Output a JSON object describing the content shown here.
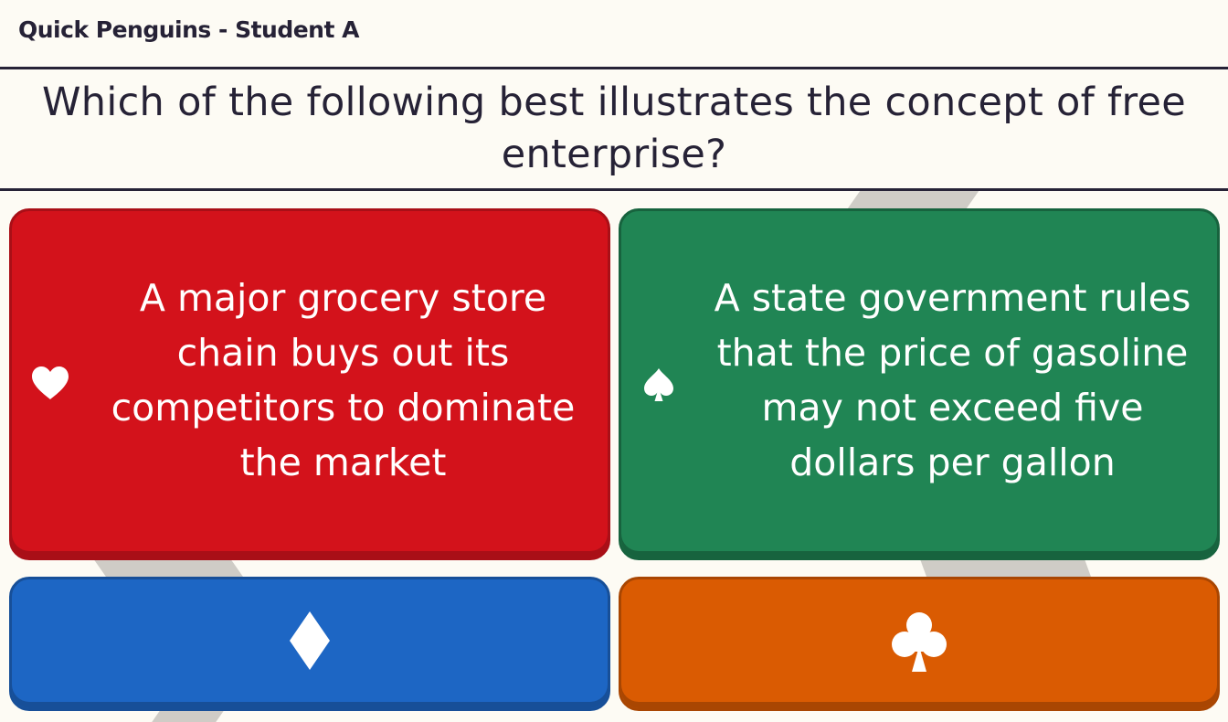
{
  "header": {
    "title": "Quick Penguins - Student A"
  },
  "question": {
    "text": "Which of the following best illustrates the concept of free enterprise?"
  },
  "answers": [
    {
      "suit": "heart-icon",
      "color": "#d3121b",
      "text": "A major grocery store chain buys out its competitors to dominate the market"
    },
    {
      "suit": "spade-icon",
      "color": "#208554",
      "text": "A state government rules that the price of gasoline may not exceed five dollars per gallon"
    },
    {
      "suit": "diamond-icon",
      "color": "#1d66c4",
      "text": ""
    },
    {
      "suit": "club-icon",
      "color": "#da5b02",
      "text": ""
    }
  ]
}
